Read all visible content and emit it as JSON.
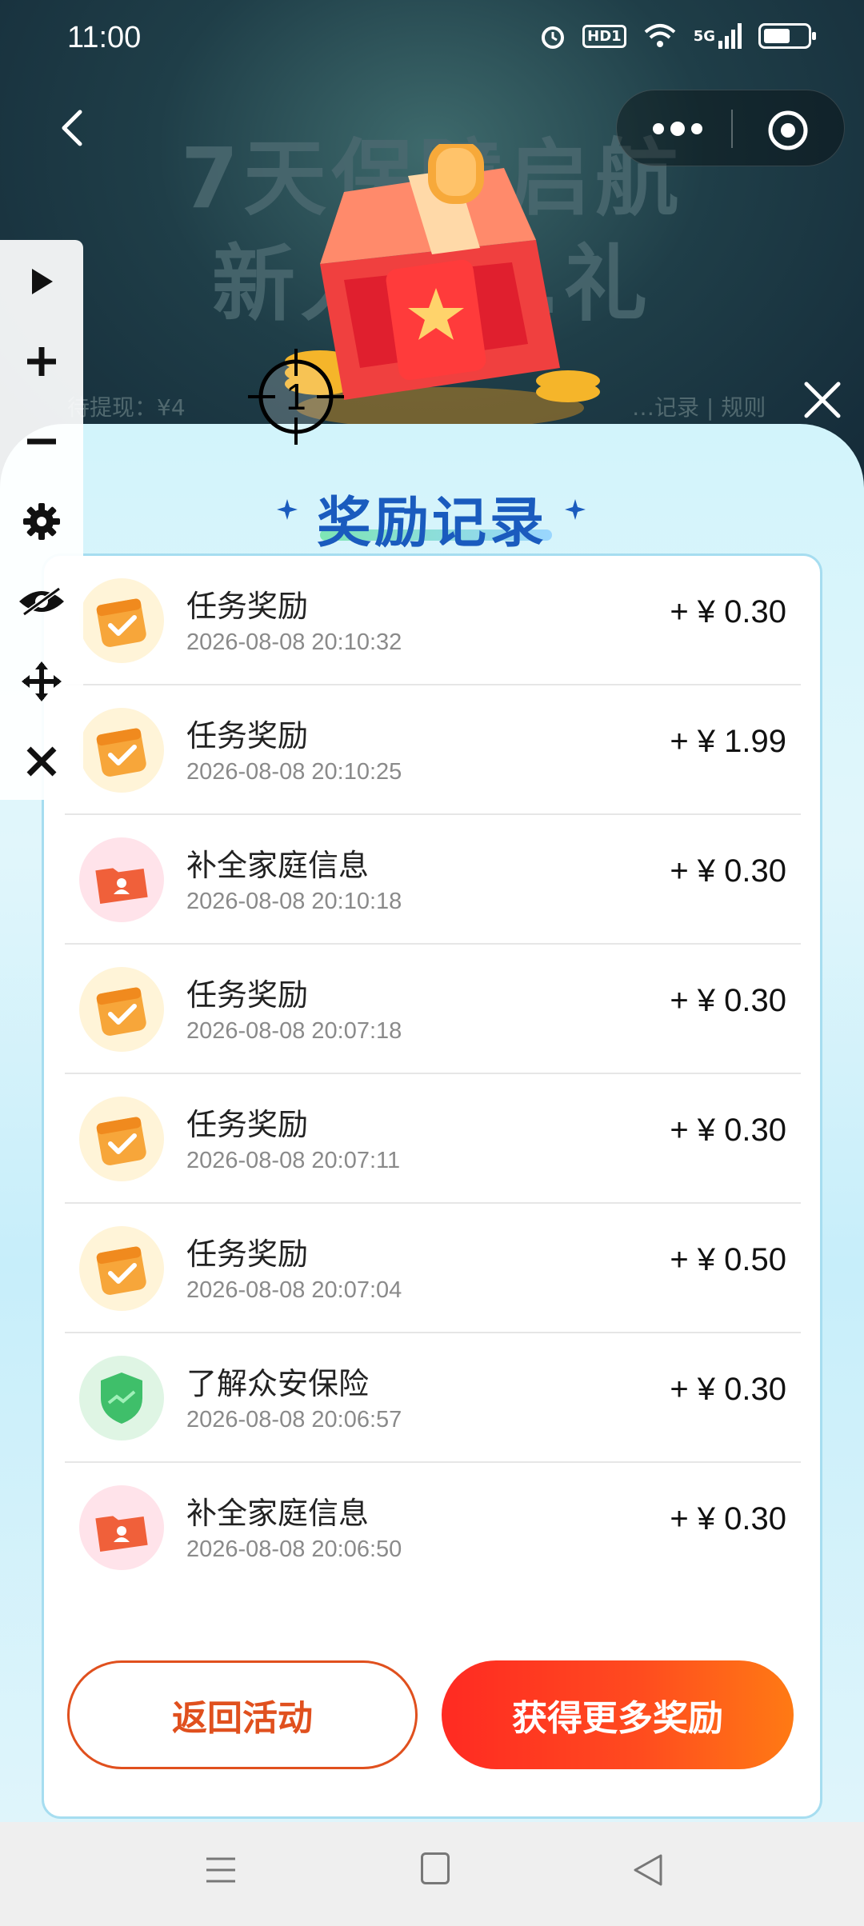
{
  "status_bar": {
    "time": "11:00",
    "hd_badge": "HD1",
    "network_badge": "5G"
  },
  "banner": {
    "title_line1": "7天保障启航",
    "title_line2": "新人……礼",
    "sub_left": "待提现：¥4",
    "sub_right": "…记录 | 规则"
  },
  "overlay": {
    "marker_number": "1"
  },
  "sheet": {
    "title": "奖励记录",
    "records": [
      {
        "name": "任务奖励",
        "time": "2026-08-08 20:10:32",
        "amount": "+ ¥ 0.30",
        "icon": "calendar-check-icon"
      },
      {
        "name": "任务奖励",
        "time": "2026-08-08 20:10:25",
        "amount": "+ ¥ 1.99",
        "icon": "calendar-check-icon"
      },
      {
        "name": "补全家庭信息",
        "time": "2026-08-08 20:10:18",
        "amount": "+ ¥ 0.30",
        "icon": "family-folder-icon"
      },
      {
        "name": "任务奖励",
        "time": "2026-08-08 20:07:18",
        "amount": "+ ¥ 0.30",
        "icon": "calendar-check-icon"
      },
      {
        "name": "任务奖励",
        "time": "2026-08-08 20:07:11",
        "amount": "+ ¥ 0.30",
        "icon": "calendar-check-icon"
      },
      {
        "name": "任务奖励",
        "time": "2026-08-08 20:07:04",
        "amount": "+ ¥ 0.50",
        "icon": "calendar-check-icon"
      },
      {
        "name": "了解众安保险",
        "time": "2026-08-08 20:06:57",
        "amount": "+ ¥ 0.30",
        "icon": "shield-icon"
      },
      {
        "name": "补全家庭信息",
        "time": "2026-08-08 20:06:50",
        "amount": "+ ¥ 0.30",
        "icon": "family-folder-icon"
      }
    ],
    "back_button": "返回活动",
    "more_button": "获得更多奖励"
  },
  "colors": {
    "accent_orange": "#e0501e",
    "title_blue": "#1a5bbe",
    "gradient_start": "#ff2a22",
    "gradient_end": "#ff7a14"
  }
}
